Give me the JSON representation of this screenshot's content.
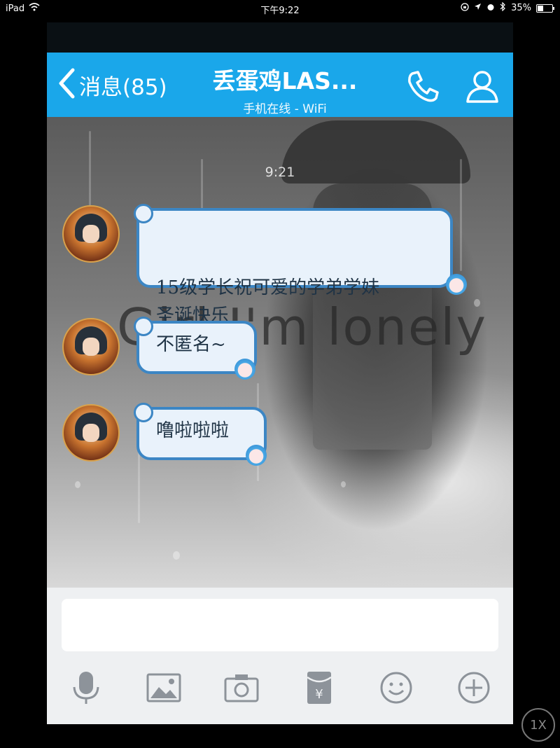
{
  "status_bar": {
    "device": "iPad",
    "time": "下午9:22",
    "battery": "35%",
    "battery_level": 0.35
  },
  "nav": {
    "back_label": "消息(85)",
    "title": "丢蛋鸡LAS...",
    "subtitle": "手机在线 - WiFi"
  },
  "chat": {
    "timestamp": "9:21",
    "wallpaper_text": "Girl I'm lonely",
    "messages": [
      {
        "text": "15级学长祝可爱的学弟学妹\n圣诞快乐"
      },
      {
        "text": "不匿名~"
      },
      {
        "text": "噜啦啦啦"
      }
    ]
  },
  "input": {
    "placeholder": ""
  },
  "toolbar": {
    "icons": [
      "microphone-icon",
      "image-icon",
      "camera-icon",
      "red-packet-icon",
      "emoji-icon",
      "plus-icon"
    ],
    "accent": "#8d939a"
  },
  "zoom_button": "1X",
  "colors": {
    "nav_bg": "#1aa7ea",
    "bubble_border": "#3c86c4",
    "bubble_bg": "#e9f2fb"
  }
}
